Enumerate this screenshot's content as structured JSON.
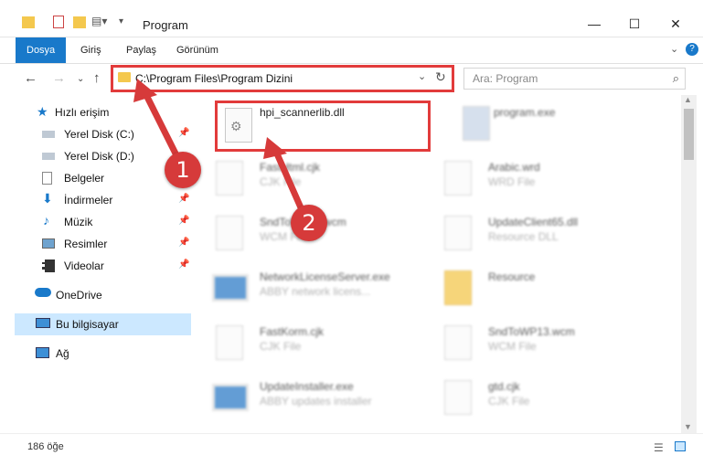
{
  "window": {
    "title": "Program"
  },
  "ribbon": {
    "tabs": [
      "Dosya",
      "Giriş",
      "Paylaş",
      "Görünüm"
    ]
  },
  "address": {
    "path": "C:\\Program Files\\Program Dizini"
  },
  "search": {
    "placeholder": "Ara: Program"
  },
  "sidebar": {
    "quick_access": "Hızlı erişim",
    "items": [
      {
        "label": "Yerel Disk (C:)",
        "icon": "drive-icon",
        "pinned": true
      },
      {
        "label": "Yerel Disk (D:)",
        "icon": "drive-icon",
        "pinned": false
      },
      {
        "label": "Belgeler",
        "icon": "documents-icon",
        "pinned": true
      },
      {
        "label": "İndirmeler",
        "icon": "download-icon",
        "pinned": true
      },
      {
        "label": "Müzik",
        "icon": "music-icon",
        "pinned": true
      },
      {
        "label": "Resimler",
        "icon": "pictures-icon",
        "pinned": true
      },
      {
        "label": "Videolar",
        "icon": "videos-icon",
        "pinned": true
      }
    ],
    "onedrive": "OneDrive",
    "this_pc": "Bu bilgisayar",
    "network": "Ağ"
  },
  "files": [
    {
      "name": "hpi_scannerlib.dll",
      "type": ""
    },
    {
      "name": "program.exe",
      "type": ""
    },
    {
      "name": "FastHtml.cjk",
      "type": "CJK File"
    },
    {
      "name": "Arabic.wrd",
      "type": "WRD File"
    },
    {
      "name": "SndToWP13.wcm",
      "type": "WCM File"
    },
    {
      "name": "UpdateClient65.dll",
      "type": "Resource DLL"
    },
    {
      "name": "NetworkLicenseServer.exe",
      "type": "ABBY network licens..."
    },
    {
      "name": "Resource",
      "type": ""
    },
    {
      "name": "FastKorm.cjk",
      "type": "CJK File"
    },
    {
      "name": "SndToWP13.wcm",
      "type": "WCM File"
    },
    {
      "name": "UpdateInstaller.exe",
      "type": "ABBY updates installer"
    },
    {
      "name": "gtd.cjk",
      "type": "CJK File"
    }
  ],
  "status": {
    "count": "186 öğe"
  },
  "annotations": {
    "step1": "1",
    "step2": "2"
  },
  "colors": {
    "accent": "#1979ca",
    "highlight": "#e23b3b",
    "selection": "#cce8ff"
  }
}
